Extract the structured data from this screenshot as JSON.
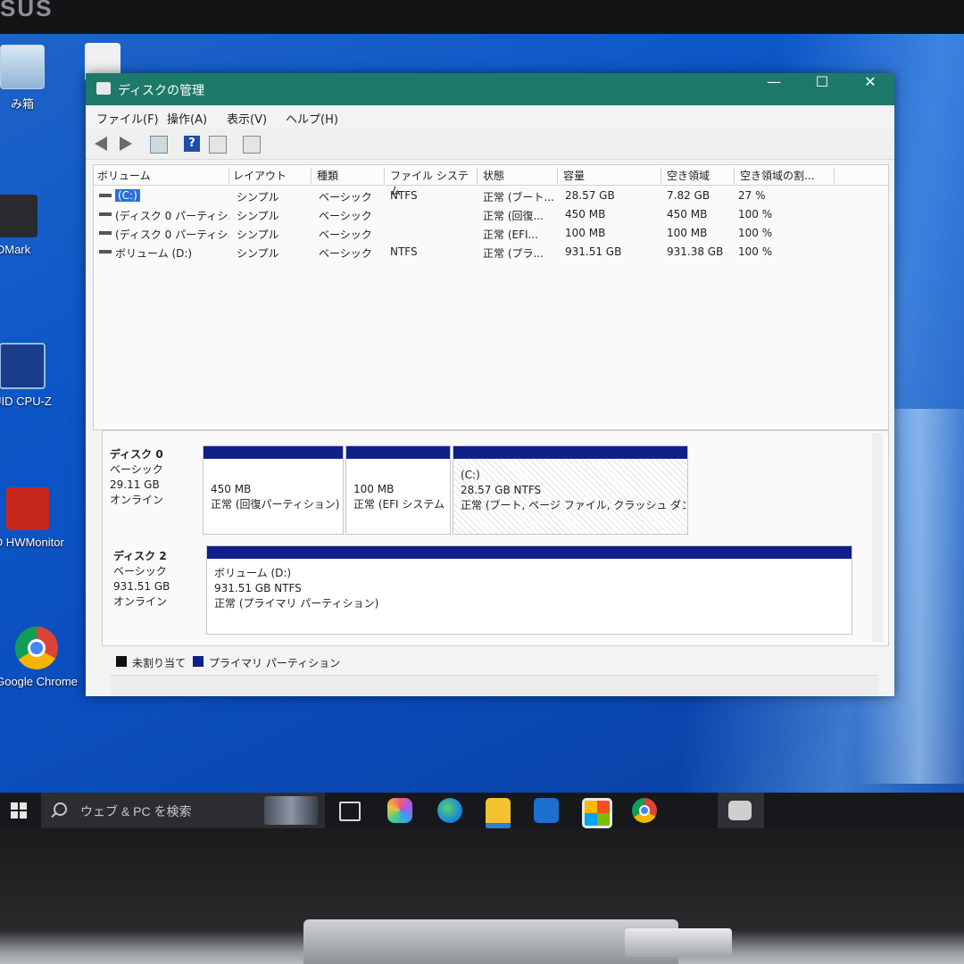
{
  "brand": "SUS",
  "desktop": {
    "icons": [
      {
        "label": "み箱"
      },
      {
        "label": "DMark"
      },
      {
        "label": "UID CPU-Z"
      },
      {
        "label": "ID HWMonitor"
      },
      {
        "label": "Google Chrome"
      }
    ]
  },
  "window": {
    "title": "ディスクの管理",
    "controls": {
      "minimize": "—",
      "maximize": "☐",
      "close": "✕"
    },
    "menu": [
      "ファイル(F)",
      "操作(A)",
      "表示(V)",
      "ヘルプ(H)"
    ],
    "columns": [
      "ボリューム",
      "レイアウト",
      "種類",
      "ファイル システム",
      "状態",
      "容量",
      "空き領域",
      "空き領域の割..."
    ],
    "volumes": [
      {
        "name": "(C:)",
        "layout": "シンプル",
        "type": "ベーシック",
        "fs": "NTFS",
        "status": "正常 (ブート...",
        "capacity": "28.57 GB",
        "free": "7.82 GB",
        "pct": "27 %"
      },
      {
        "name": "(ディスク 0 パーティシ...",
        "layout": "シンプル",
        "type": "ベーシック",
        "fs": "",
        "status": "正常 (回復...",
        "capacity": "450 MB",
        "free": "450 MB",
        "pct": "100 %"
      },
      {
        "name": "(ディスク 0 パーティシ...",
        "layout": "シンプル",
        "type": "ベーシック",
        "fs": "",
        "status": "正常 (EFI...",
        "capacity": "100 MB",
        "free": "100 MB",
        "pct": "100 %"
      },
      {
        "name": "ボリューム (D:)",
        "layout": "シンプル",
        "type": "ベーシック",
        "fs": "NTFS",
        "status": "正常 (プラ...",
        "capacity": "931.51 GB",
        "free": "931.38 GB",
        "pct": "100 %"
      }
    ],
    "disks": [
      {
        "name": "ディスク 0",
        "type": "ベーシック",
        "size": "29.11 GB",
        "state": "オンライン",
        "partitions": [
          {
            "line1": "450 MB",
            "line2": "正常 (回復パーティション)"
          },
          {
            "line1": "100 MB",
            "line2": "正常 (EFI システム"
          },
          {
            "title": "(C:)",
            "line1": "28.57 GB NTFS",
            "line2": "正常 (ブート, ページ ファイル, クラッシュ ダンプ, ベ"
          }
        ]
      },
      {
        "name": "ディスク 2",
        "type": "ベーシック",
        "size": "931.51 GB",
        "state": "オンライン",
        "partitions": [
          {
            "title": "ボリューム (D:)",
            "line1": "931.51 GB NTFS",
            "line2": "正常 (プライマリ パーティション)"
          }
        ]
      }
    ],
    "legend": [
      {
        "label": "未割り当て",
        "color": "#111111"
      },
      {
        "label": "プライマリ パーティション",
        "color": "#10208a"
      }
    ]
  },
  "taskbar": {
    "search_placeholder": "ウェブ & PC を検索"
  }
}
